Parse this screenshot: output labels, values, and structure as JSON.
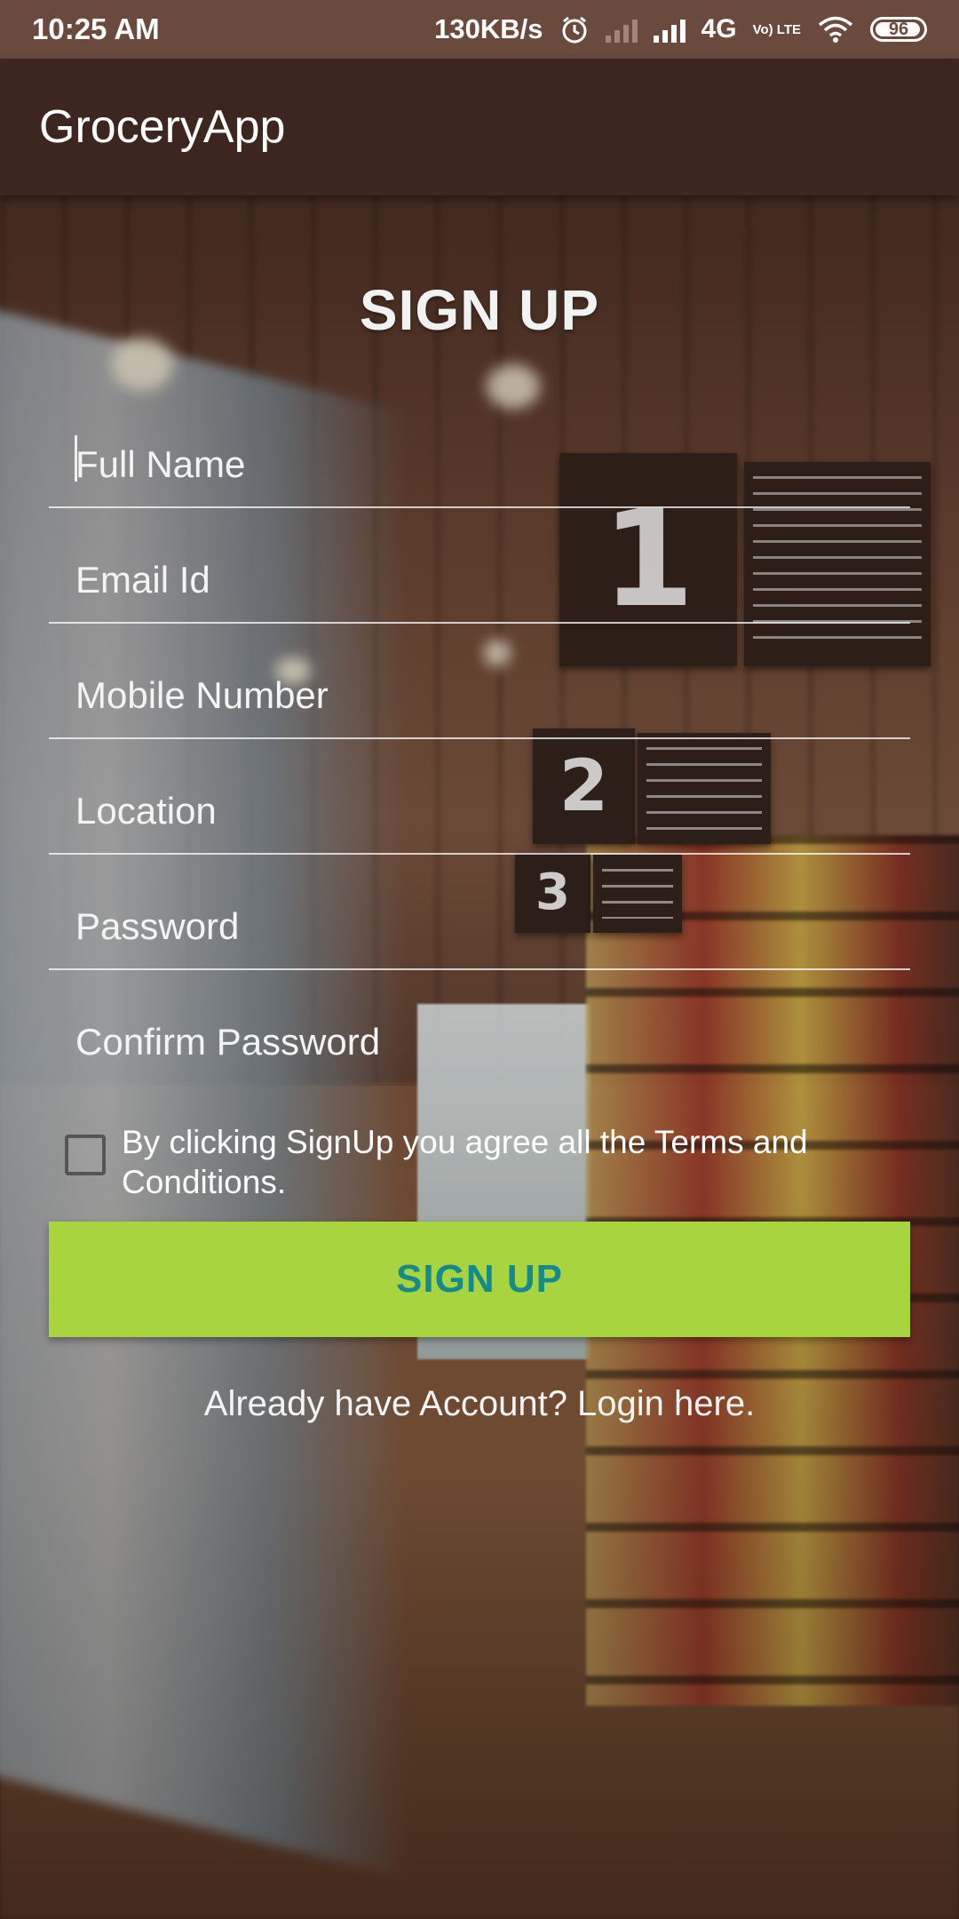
{
  "status_bar": {
    "time": "10:25 AM",
    "speed": "130KB/s",
    "network": "4G",
    "volte": "Vo) LTE",
    "battery": "96",
    "battery_level_percent": 96,
    "icons": [
      "alarm-icon",
      "signal-icon",
      "signal-icon",
      "wifi-icon",
      "battery-icon"
    ]
  },
  "app_bar": {
    "title": "GroceryApp"
  },
  "form": {
    "title": "SIGN UP",
    "fields": [
      {
        "placeholder": "Full Name",
        "value": ""
      },
      {
        "placeholder": "Email Id",
        "value": ""
      },
      {
        "placeholder": "Mobile Number",
        "value": ""
      },
      {
        "placeholder": "Location",
        "value": ""
      },
      {
        "placeholder": "Password",
        "value": ""
      },
      {
        "placeholder": "Confirm Password",
        "value": ""
      }
    ],
    "terms_checked": false,
    "terms_text": "By clicking SignUp you agree all the Terms and Conditions.",
    "signup_button": "SIGN UP",
    "login_link": "Already have Account? Login here."
  },
  "background": {
    "sign_1": "1",
    "sign_2": "2",
    "sign_3": "3"
  },
  "colors": {
    "status_bar": "#6b4a3e",
    "app_bar": "#3e2620",
    "button_bg": "#a7d43f",
    "button_text": "#16898b"
  }
}
